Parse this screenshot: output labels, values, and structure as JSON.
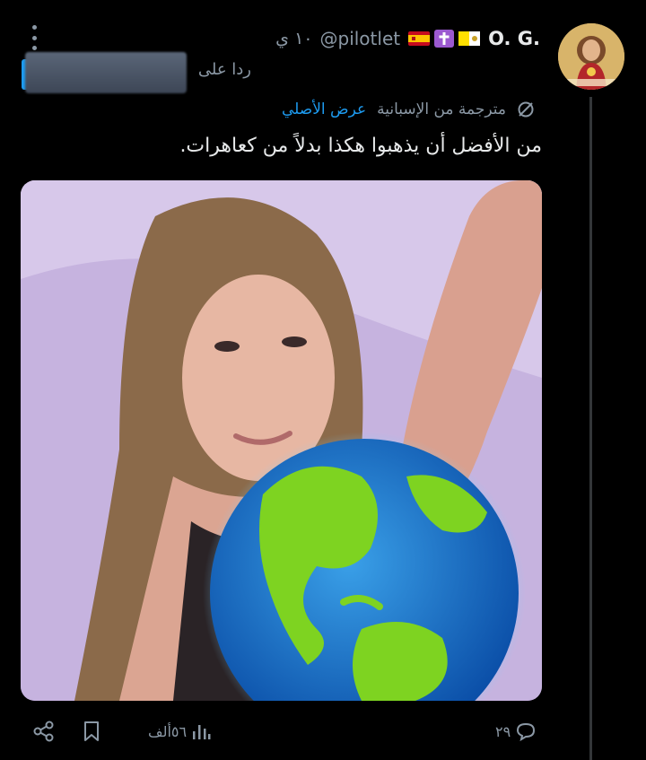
{
  "post": {
    "author": {
      "display_name": "O. G.",
      "handle": "@pilotlet",
      "badges": [
        "spain-flag-icon",
        "latin-cross-icon",
        "vatican-flag-icon"
      ]
    },
    "time_ago": "١٠ ي",
    "reply_to_label": "ردا على",
    "translation": {
      "label": "مترجمة من الإسبانية",
      "show_original": "عرض الأصلي"
    },
    "text": "من الأفضل أن يذهبوا هكذا بدلاً من كعاهرات."
  },
  "actions": {
    "replies": "٢٩",
    "views": "٥٦ألف"
  },
  "colors": {
    "background": "#000000",
    "text": "#e7e9ea",
    "muted": "#8b98a5",
    "accent": "#1d9bf0"
  }
}
